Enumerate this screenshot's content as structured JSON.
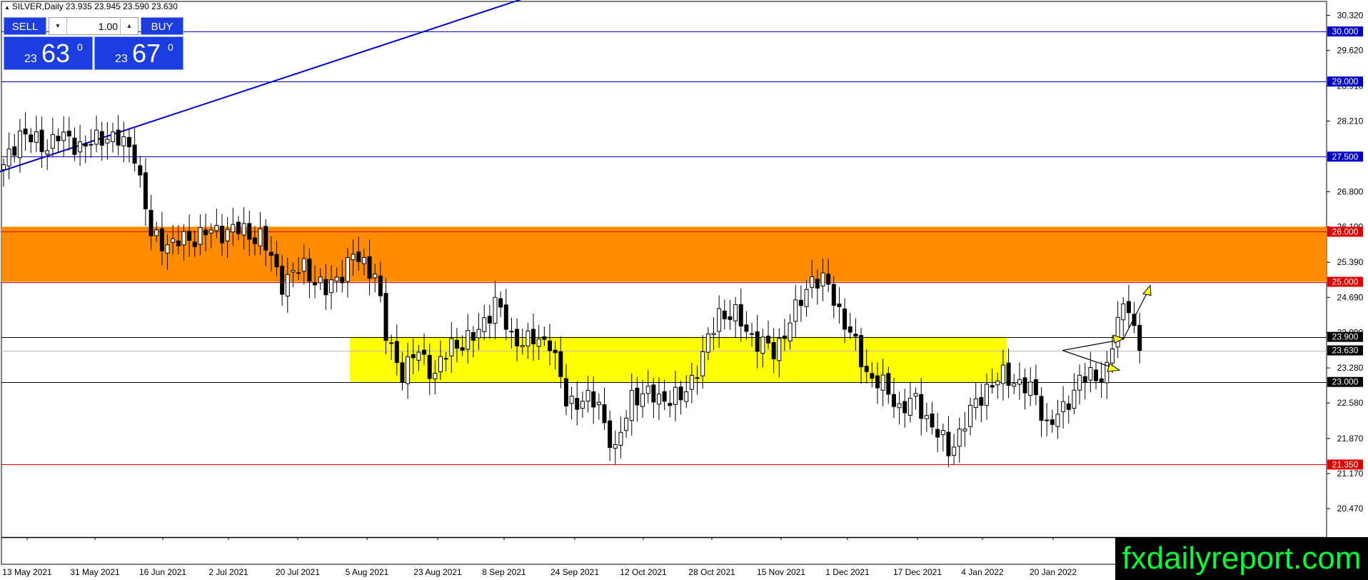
{
  "header": {
    "symbol_line": "SILVER,Daily  23.935 23.945 23.590 23.630"
  },
  "trade_panel": {
    "sell_label": "SELL",
    "buy_label": "BUY",
    "lot_value": "1.00",
    "bid": {
      "small": "23",
      "large": "63",
      "sup": "0"
    },
    "ask": {
      "small": "23",
      "large": "67",
      "sup": "0"
    }
  },
  "chart_data": {
    "type": "candlestick",
    "symbol": "SILVER",
    "timeframe": "Daily",
    "ohlc_readout": {
      "open": 23.935,
      "high": 23.945,
      "low": 23.59,
      "close": 23.63
    },
    "ylim": [
      19.9,
      30.6
    ],
    "y_ticks": [
      "30.320",
      "29.620",
      "28.910",
      "28.210",
      "26.800",
      "26.100",
      "25.390",
      "24.690",
      "23.990",
      "23.280",
      "22.580",
      "21.870",
      "21.170",
      "20.470"
    ],
    "x_ticks": [
      "13 May 2021",
      "31 May 2021",
      "16 Jun 2021",
      "2 Jul 2021",
      "20 Jul 2021",
      "5 Aug 2021",
      "23 Aug 2021",
      "8 Sep 2021",
      "24 Sep 2021",
      "12 Oct 2021",
      "28 Oct 2021",
      "15 Nov 2021",
      "1 Dec 2021",
      "17 Dec 2021",
      "4 Jan 2022",
      "20 Jan 2022"
    ],
    "level_labels": [
      {
        "value": 30.0,
        "label": "30.000",
        "color": "#0000cc"
      },
      {
        "value": 29.0,
        "label": "29.000",
        "color": "#0000cc"
      },
      {
        "value": 27.5,
        "label": "27.500",
        "color": "#0000cc"
      },
      {
        "value": 26.0,
        "label": "26.000",
        "color": "#e00000"
      },
      {
        "value": 25.0,
        "label": "25.000",
        "color": "#e00000"
      },
      {
        "value": 23.9,
        "label": "23.900",
        "color": "#000000"
      },
      {
        "value": 23.63,
        "label": "23.630",
        "color": "#000000"
      },
      {
        "value": 23.0,
        "label": "23.000",
        "color": "#000000"
      },
      {
        "value": 21.35,
        "label": "21.350",
        "color": "#e00000"
      }
    ],
    "zones": [
      {
        "from": 25.0,
        "to": 26.1,
        "color": "#ff8c00",
        "border": "#e00000"
      },
      {
        "from": 23.0,
        "to": 23.9,
        "color": "#ffff00",
        "border": "#000000"
      }
    ],
    "trendline": {
      "from": [
        "13 May 2021",
        27.2
      ],
      "to": [
        "23 Aug 2021",
        31.0
      ],
      "color": "#0000cc"
    },
    "anchors": [
      [
        0,
        27.25
      ],
      [
        3,
        28.0
      ],
      [
        7,
        27.7
      ],
      [
        10,
        27.9
      ],
      [
        15,
        27.7
      ],
      [
        19,
        27.95
      ],
      [
        24,
        27.6
      ],
      [
        27,
        25.9
      ],
      [
        31,
        25.75
      ],
      [
        36,
        25.95
      ],
      [
        42,
        26.05
      ],
      [
        47,
        25.9
      ],
      [
        51,
        25.0
      ],
      [
        55,
        25.3
      ],
      [
        59,
        24.8
      ],
      [
        64,
        25.5
      ],
      [
        68,
        25.2
      ],
      [
        70,
        23.9
      ],
      [
        73,
        23.2
      ],
      [
        76,
        23.6
      ],
      [
        79,
        23.15
      ],
      [
        82,
        23.75
      ],
      [
        86,
        23.85
      ],
      [
        90,
        24.6
      ],
      [
        93,
        23.9
      ],
      [
        96,
        23.8
      ],
      [
        100,
        23.85
      ],
      [
        103,
        22.6
      ],
      [
        106,
        22.65
      ],
      [
        109,
        22.55
      ],
      [
        112,
        21.55
      ],
      [
        115,
        22.75
      ],
      [
        120,
        22.7
      ],
      [
        124,
        22.65
      ],
      [
        128,
        23.5
      ],
      [
        131,
        24.4
      ],
      [
        134,
        24.3
      ],
      [
        138,
        23.8
      ],
      [
        141,
        23.6
      ],
      [
        145,
        24.4
      ],
      [
        148,
        25.1
      ],
      [
        151,
        24.9
      ],
      [
        154,
        24.2
      ],
      [
        158,
        23.2
      ],
      [
        161,
        22.9
      ],
      [
        164,
        22.5
      ],
      [
        167,
        22.6
      ],
      [
        170,
        22.15
      ],
      [
        173,
        21.6
      ],
      [
        176,
        22.2
      ],
      [
        180,
        22.9
      ],
      [
        183,
        23.1
      ],
      [
        186,
        23.0
      ],
      [
        189,
        22.7
      ],
      [
        191,
        22.15
      ],
      [
        194,
        22.4
      ],
      [
        197,
        23.1
      ],
      [
        200,
        23.05
      ],
      [
        202,
        23.3
      ],
      [
        204,
        24.2
      ],
      [
        206,
        24.6
      ],
      [
        208,
        23.63
      ]
    ]
  },
  "watermark": "fxdailyreport.com"
}
